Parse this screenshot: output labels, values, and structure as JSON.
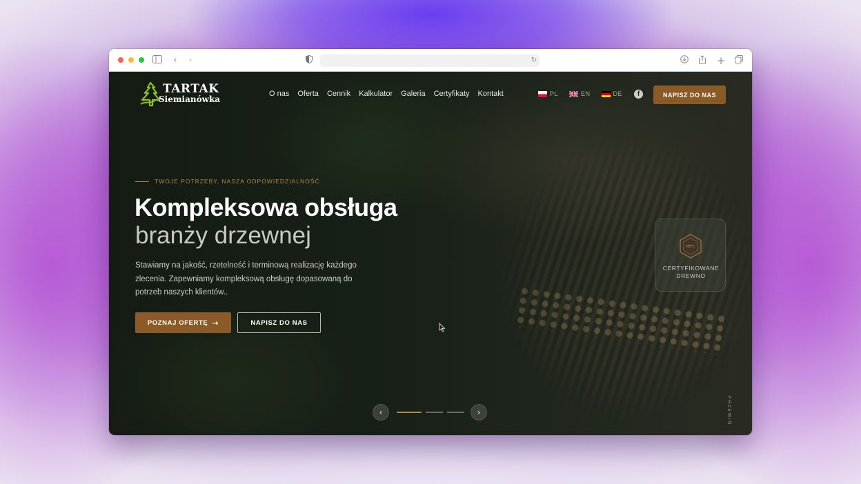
{
  "browser": {
    "traffic_lights": [
      "#ff5f57",
      "#febc2e",
      "#28c840"
    ],
    "icons": [
      "sidebar-icon",
      "back-icon",
      "forward-icon",
      "shield-icon",
      "reload-icon",
      "download-icon",
      "share-icon",
      "new-tab-icon",
      "tabs-overview-icon"
    ]
  },
  "header": {
    "logo_title": "TARTAK",
    "logo_subtitle": "Siemianówka",
    "nav": [
      "O nas",
      "Oferta",
      "Cennik",
      "Kalkulator",
      "Galeria",
      "Certyfikaty",
      "Kontakt"
    ],
    "languages": [
      {
        "code": "PL",
        "flag": "poland-flag-icon"
      },
      {
        "code": "EN",
        "flag": "uk-flag-icon"
      },
      {
        "code": "DE",
        "flag": "germany-flag-icon"
      }
    ],
    "cta": "NAPISZ DO NAS"
  },
  "hero": {
    "eyebrow": "TWOJE POTRZEBY, NASZA ODPOWIEDZIALNOŚĆ",
    "title_line1": "Kompleksowa obsługa",
    "title_line2": "branży drzewnej",
    "lead": "Stawiamy na jakość, rzetelność i terminową realizację każdego zlecenia. Zapewniamy kompleksową obsługę dopasowaną do potrzeb naszych klientów..",
    "primary_button": "POZNAJ OFERTĘ",
    "secondary_button": "NAPISZ DO NAS"
  },
  "certificate": {
    "badge_text": "PEFC",
    "label_line1": "CERTYFIKOWANE",
    "label_line2": "DREWNO"
  },
  "slider": {
    "slides_total": 3,
    "active_slide": 1
  },
  "scroll_hint": "PRZEWIŃ",
  "colors": {
    "accent": "#8a5a27",
    "accent_text": "#b5874b"
  }
}
